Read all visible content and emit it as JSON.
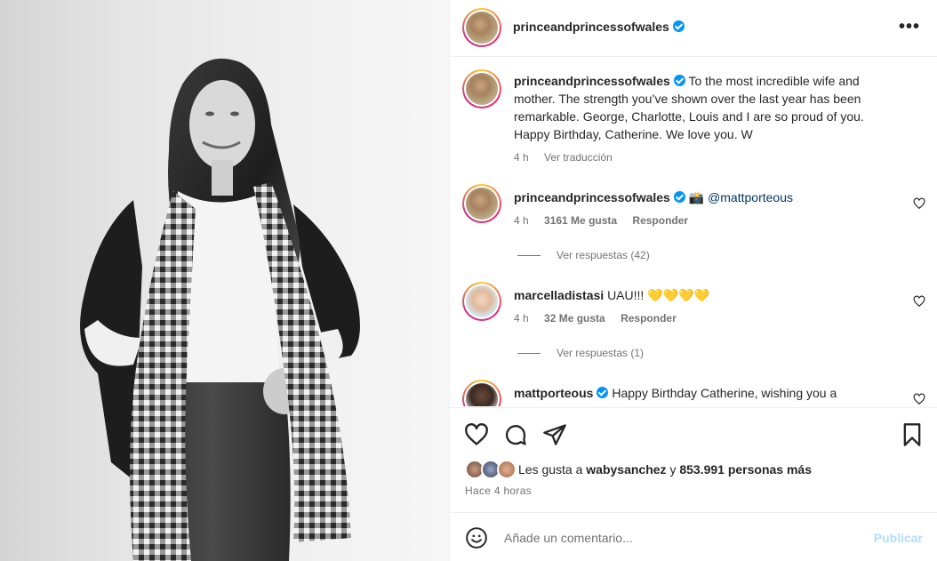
{
  "post": {
    "username": "princeandprincessofwales",
    "more_label": "•••"
  },
  "caption": {
    "username": "princeandprincessofwales",
    "text": "To the most incredible wife and mother. The strength you’ve shown over the last year has been remarkable. George, Charlotte, Louis and I are so proud of you. Happy Birthday, Catherine. We love you. W",
    "time": "4 h",
    "translate": "Ver traducción"
  },
  "comments": [
    {
      "username": "princeandprincessofwales",
      "emoji": "📸",
      "text": "@mattporteous",
      "time": "4 h",
      "likes": "3161 Me gusta",
      "reply": "Responder",
      "view_replies": "Ver respuestas (42)"
    },
    {
      "username": "marcelladistasi",
      "text": "UAU!!! 💛💛💛💛",
      "time": "4 h",
      "likes": "32 Me gusta",
      "reply": "Responder",
      "view_replies": "Ver respuestas (1)"
    },
    {
      "username": "mattporteous",
      "text": "Happy Birthday Catherine, wishing you a"
    }
  ],
  "actions": {
    "icons": [
      "heart-icon",
      "comment-icon",
      "share-icon",
      "bookmark-icon"
    ],
    "likes_prefix": "Les gusta a",
    "likes_user": "wabysanchez",
    "likes_middle": "y",
    "likes_count": "853.991 personas más",
    "time_ago": "Hace 4 horas"
  },
  "comment_box": {
    "placeholder": "Añade un comentario...",
    "publish": "Publicar"
  },
  "colors": {
    "verified": "#0095f6",
    "publish_disabled": "#b2dffc",
    "secondary_text": "#737373"
  }
}
